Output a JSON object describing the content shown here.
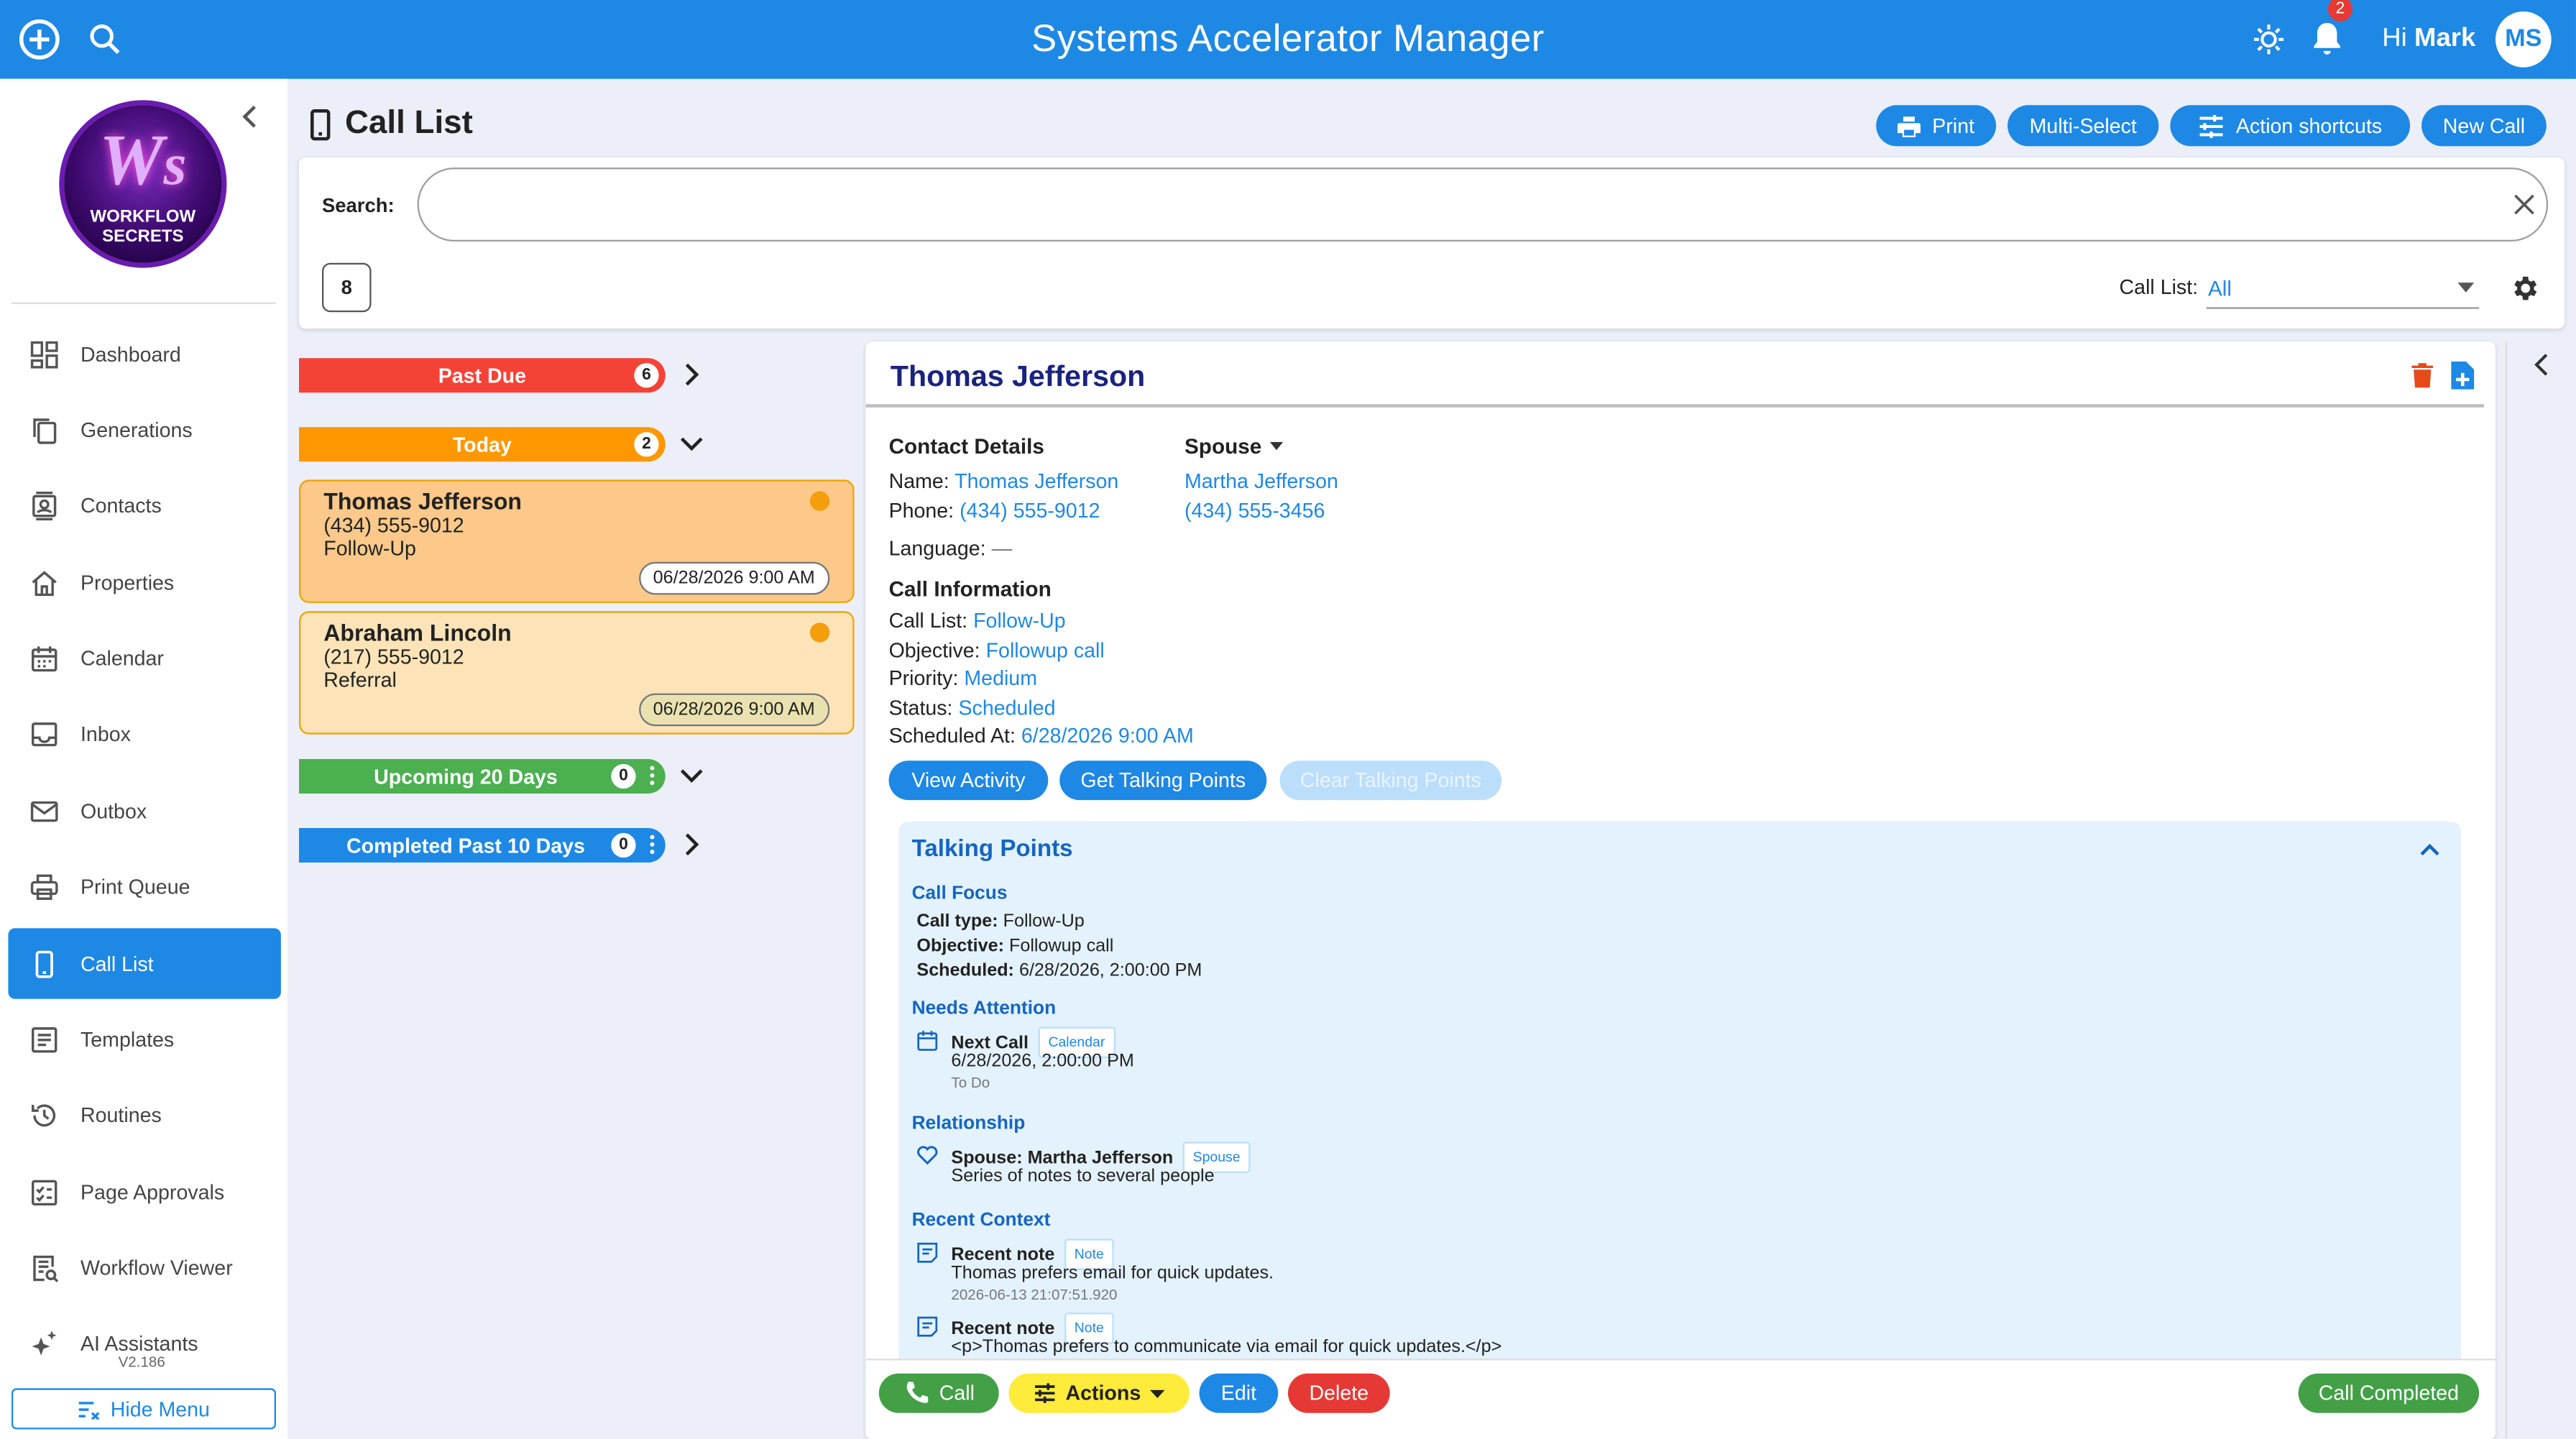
{
  "app": {
    "title": "Systems Accelerator Manager",
    "greeting": "Hi",
    "user_name": "Mark",
    "user_initials": "MS",
    "notifications_count": "2"
  },
  "sidebar": {
    "logo_line1": "WORKFLOW",
    "logo_line2": "SECRETS",
    "items": [
      {
        "label": "Dashboard",
        "icon": "dashboard-icon"
      },
      {
        "label": "Generations",
        "icon": "copy-icon"
      },
      {
        "label": "Contacts",
        "icon": "contacts-icon"
      },
      {
        "label": "Properties",
        "icon": "home-icon"
      },
      {
        "label": "Calendar",
        "icon": "calendar-icon"
      },
      {
        "label": "Inbox",
        "icon": "inbox-icon"
      },
      {
        "label": "Outbox",
        "icon": "mail-icon"
      },
      {
        "label": "Print Queue",
        "icon": "printer-icon"
      },
      {
        "label": "Call List",
        "icon": "phone-icon",
        "active": true
      },
      {
        "label": "Templates",
        "icon": "list-icon"
      },
      {
        "label": "Routines",
        "icon": "history-icon"
      },
      {
        "label": "Page Approvals",
        "icon": "checklist-icon"
      },
      {
        "label": "Workflow Viewer",
        "icon": "search-list-icon"
      },
      {
        "label": "AI Assistants",
        "icon": "sparkle-icon"
      }
    ],
    "version": "V2.186",
    "hide_menu": "Hide Menu"
  },
  "header": {
    "title": "Call List",
    "buttons": {
      "print": "Print",
      "multi_select": "Multi-Select",
      "action_shortcuts": "Action shortcuts",
      "new_call": "New Call"
    }
  },
  "search": {
    "label": "Search:",
    "value": "",
    "count": "8",
    "call_list_label": "Call List:",
    "call_list_value": "All"
  },
  "groups": [
    {
      "label": "Past Due",
      "count": "6",
      "color": "#f44336"
    },
    {
      "label": "Today",
      "count": "2",
      "color": "#ff9800"
    },
    {
      "label": "Upcoming 20 Days",
      "count": "0",
      "color": "#4caf50"
    },
    {
      "label": "Completed Past 10 Days",
      "count": "0",
      "color": "#1e88e5"
    }
  ],
  "calls": [
    {
      "name": "Thomas Jefferson",
      "phone": "(434) 555-9012",
      "type": "Follow-Up",
      "date": "06/28/2026 9:00 AM"
    },
    {
      "name": "Abraham Lincoln",
      "phone": "(217) 555-9012",
      "type": "Referral",
      "date": "06/28/2026 9:00 AM"
    }
  ],
  "detail": {
    "name": "Thomas Jefferson",
    "contact_heading": "Contact Details",
    "name_label": "Name:",
    "name_value": "Thomas Jefferson",
    "phone_label": "Phone:",
    "phone_value": "(434) 555-9012",
    "language_label": "Language:",
    "language_value": "—",
    "spouse_heading": "Spouse",
    "spouse_name": "Martha Jefferson",
    "spouse_phone": "(434) 555-3456",
    "call_info_heading": "Call Information",
    "call_list_label": "Call List:",
    "call_list_value": "Follow-Up",
    "objective_label": "Objective:",
    "objective_value": "Followup call",
    "priority_label": "Priority:",
    "priority_value": "Medium",
    "status_label": "Status:",
    "status_value": "Scheduled",
    "scheduled_label": "Scheduled At:",
    "scheduled_value": "6/28/2026 9:00 AM",
    "buttons": {
      "view_activity": "View Activity",
      "get_talking_points": "Get Talking Points",
      "clear_talking_points": "Clear Talking Points"
    }
  },
  "talking_points": {
    "title": "Talking Points",
    "call_focus": {
      "heading": "Call Focus",
      "call_type_label": "Call type:",
      "call_type_value": "Follow-Up",
      "objective_label": "Objective:",
      "objective_value": "Followup call",
      "scheduled_label": "Scheduled:",
      "scheduled_value": "6/28/2026, 2:00:00 PM"
    },
    "needs_attention": {
      "heading": "Needs Attention",
      "title": "Next Call",
      "tag": "Calendar",
      "line1": "6/28/2026, 2:00:00 PM",
      "line2": "To Do"
    },
    "relationship": {
      "heading": "Relationship",
      "title": "Spouse: Martha Jefferson",
      "tag": "Spouse",
      "line1": "Series of notes to several people"
    },
    "recent_context": {
      "heading": "Recent Context",
      "items": [
        {
          "title": "Recent note",
          "tag": "Note",
          "line1": "Thomas prefers email for quick updates.",
          "line2": "2026-06-13 21:07:51.920"
        },
        {
          "title": "Recent note",
          "tag": "Note",
          "line1": "<p>Thomas prefers to communicate via email for quick updates.</p>"
        }
      ]
    }
  },
  "footer": {
    "call": "Call",
    "actions": "Actions",
    "edit": "Edit",
    "delete": "Delete",
    "call_completed": "Call Completed"
  }
}
